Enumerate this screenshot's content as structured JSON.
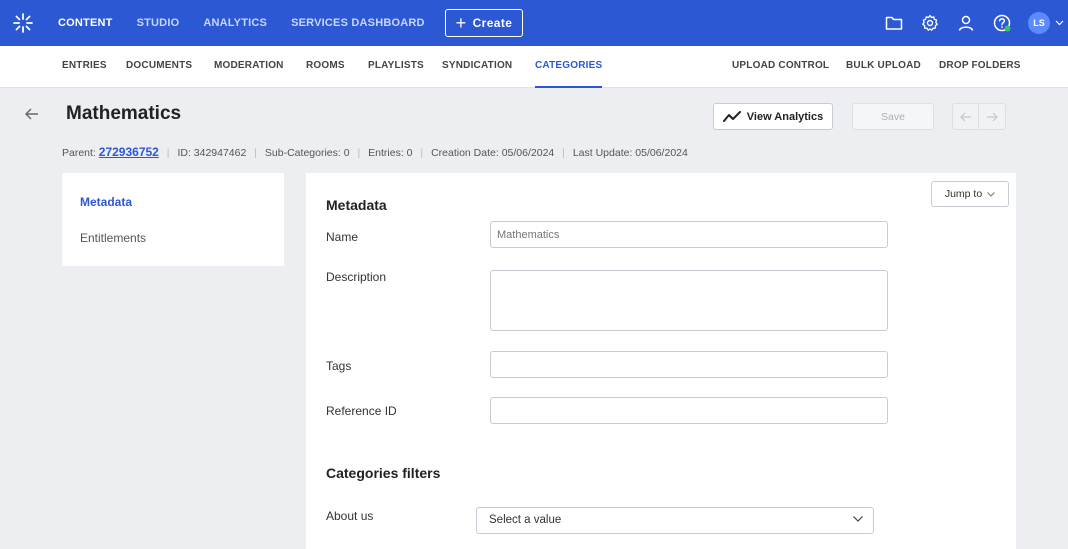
{
  "topbar": {
    "nav": [
      "CONTENT",
      "STUDIO",
      "ANALYTICS",
      "SERVICES DASHBOARD"
    ],
    "active_nav": "CONTENT",
    "create_label": "Create",
    "avatar_initials": "LS",
    "accent_color": "#2d58d4"
  },
  "subnav": {
    "items": [
      "ENTRIES",
      "DOCUMENTS",
      "MODERATION",
      "ROOMS",
      "PLAYLISTS",
      "SYNDICATION",
      "CATEGORIES"
    ],
    "right_items": [
      "UPLOAD CONTROL",
      "BULK UPLOAD",
      "DROP FOLDERS"
    ],
    "active": "CATEGORIES"
  },
  "header": {
    "title": "Mathematics",
    "parent_label": "Parent:",
    "parent_id": "272936752",
    "id_text": "ID: 342947462",
    "subcategories_text": "Sub-Categories: 0",
    "entries_text": "Entries: 0",
    "creation_text": "Creation Date: 05/06/2024",
    "update_text": "Last Update: 05/06/2024",
    "analytics_label": "View Analytics",
    "save_label": "Save"
  },
  "left_menu": {
    "items": [
      "Metadata",
      "Entitlements"
    ],
    "active": "Metadata"
  },
  "main": {
    "jump_to_label": "Jump to",
    "section_title": "Metadata",
    "fields": {
      "name_label": "Name",
      "name_placeholder": "Mathematics",
      "description_label": "Description",
      "tags_label": "Tags",
      "reference_label": "Reference ID"
    },
    "filters_title": "Categories filters",
    "about_label": "About us",
    "about_select": "Select a value"
  }
}
